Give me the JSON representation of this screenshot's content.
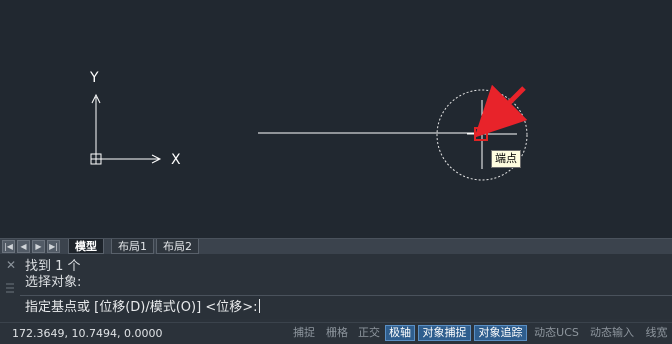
{
  "canvas": {
    "axis_y_label": "Y",
    "axis_x_label": "X",
    "tooltip": "端点"
  },
  "colors": {
    "background": "#212830",
    "snap_marker": "#e02424",
    "arrow": "#e8232a",
    "active_toggle": "#2f5e8e"
  },
  "tabs": [
    {
      "label": "模型",
      "active": true
    },
    {
      "label": "布局1",
      "active": false
    },
    {
      "label": "布局2",
      "active": false
    }
  ],
  "command": {
    "history": [
      "找到 1 个",
      "选择对象:"
    ],
    "prompt": "指定基点或 [位移(D)/模式(O)] <位移>:"
  },
  "status": {
    "coords": "172.3649, 10.7494, 0.0000",
    "buttons": [
      {
        "label": "捕捉",
        "on": false
      },
      {
        "label": "栅格",
        "on": false
      },
      {
        "label": "正交",
        "on": false
      },
      {
        "label": "极轴",
        "on": true
      },
      {
        "label": "对象捕捉",
        "on": true
      },
      {
        "label": "对象追踪",
        "on": true
      },
      {
        "label": "动态UCS",
        "on": false
      },
      {
        "label": "动态输入",
        "on": false
      },
      {
        "label": "线宽",
        "on": false
      }
    ]
  }
}
